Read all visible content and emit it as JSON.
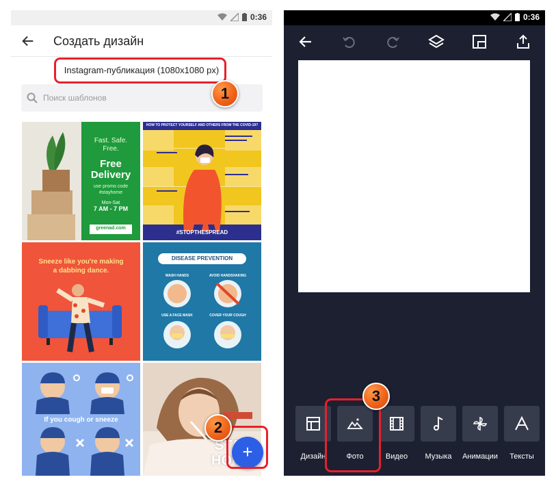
{
  "left_screen": {
    "status": {
      "time": "0:36"
    },
    "appbar": {
      "title": "Создать дизайн"
    },
    "size_label": "Instagram-публикация (1080x1080 px)",
    "search": {
      "placeholder": "Поиск шаблонов"
    },
    "templates": [
      {
        "name": "free-delivery",
        "lines": [
          "Fast. Safe.",
          "Free.",
          "Free",
          "Delivery",
          "use promo code",
          "#stayhome",
          "Mon-Sat",
          "7 AM - 7 PM",
          "greenad.com"
        ]
      },
      {
        "name": "stop-the-spread",
        "lines": [
          "HOW TO PROTECT YOURSELF AND OTHERS FROM THE COVID-19?",
          "#STOPTHESPREAD"
        ]
      },
      {
        "name": "dabbing-dance",
        "lines": [
          "Sneeze like you're making",
          "a dabbing dance."
        ]
      },
      {
        "name": "disease-prevention",
        "lines": [
          "DISEASE PREVENTION",
          "WASH HANDS",
          "AVOID HANDSHAKING",
          "USE A FACE MASK",
          "COVER YOUR COUGH"
        ]
      },
      {
        "name": "cough-or-sneeze",
        "lines": [
          "If you cough or sneeze"
        ]
      },
      {
        "name": "stay-home",
        "lines": [
          "STAY",
          "HOME"
        ]
      }
    ],
    "fab": {
      "label": "+"
    }
  },
  "right_screen": {
    "status": {
      "time": "0:36"
    },
    "tools": [
      {
        "label": "Дизайн",
        "icon": "layout-icon"
      },
      {
        "label": "Фото",
        "icon": "image-icon"
      },
      {
        "label": "Видео",
        "icon": "film-icon"
      },
      {
        "label": "Музыка",
        "icon": "music-note-icon"
      },
      {
        "label": "Анимации",
        "icon": "pinwheel-icon"
      },
      {
        "label": "Тексты",
        "icon": "text-icon"
      }
    ]
  },
  "annotations": {
    "step1": "1",
    "step2": "2",
    "step3": "3"
  },
  "colors": {
    "highlight": "#e8202a",
    "badge": "#f0631a",
    "fab": "#2d5fe6",
    "editor_bg": "#1c2031",
    "tool_bg": "#373c4d"
  }
}
